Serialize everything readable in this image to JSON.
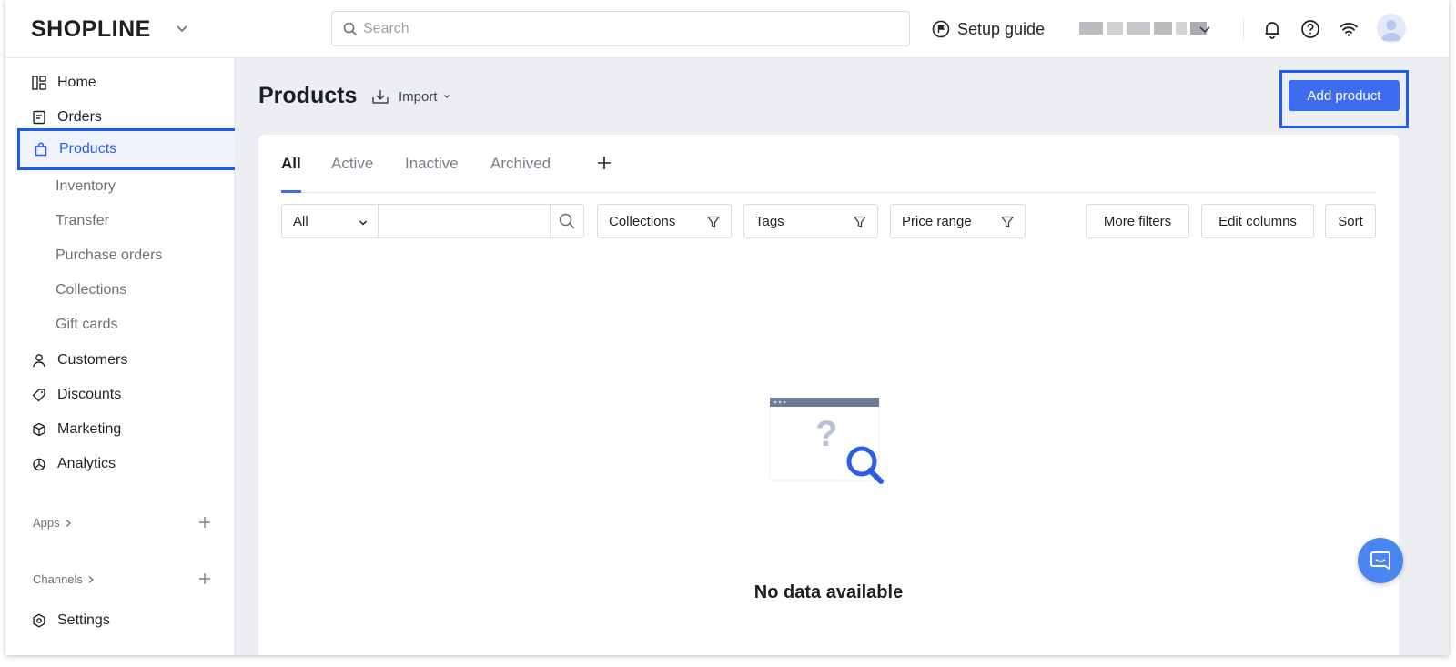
{
  "app": {
    "logo": "SHOPLINE",
    "search_placeholder": "Search",
    "setup_guide": "Setup guide"
  },
  "sidebar": {
    "items": [
      {
        "label": "Home",
        "icon": "home-icon"
      },
      {
        "label": "Orders",
        "icon": "orders-icon"
      },
      {
        "label": "Products",
        "icon": "bag-icon",
        "active": true
      },
      {
        "label": "Inventory",
        "sub": true
      },
      {
        "label": "Transfer",
        "sub": true
      },
      {
        "label": "Purchase orders",
        "sub": true
      },
      {
        "label": "Collections",
        "sub": true
      },
      {
        "label": "Gift cards",
        "sub": true
      },
      {
        "label": "Customers",
        "icon": "user-icon"
      },
      {
        "label": "Discounts",
        "icon": "tag-icon"
      },
      {
        "label": "Marketing",
        "icon": "cube-icon"
      },
      {
        "label": "Analytics",
        "icon": "pie-chart-icon"
      }
    ],
    "apps_label": "Apps",
    "channels_label": "Channels",
    "settings_label": "Settings"
  },
  "page": {
    "title": "Products",
    "import_label": "Import",
    "add_product_label": "Add product"
  },
  "tabs": [
    "All",
    "Active",
    "Inactive",
    "Archived"
  ],
  "filters": {
    "select_value": "All",
    "collections": "Collections",
    "tags": "Tags",
    "price_range": "Price range",
    "more_filters": "More filters",
    "edit_columns": "Edit columns",
    "sort": "Sort"
  },
  "empty_state": {
    "message": "No data available"
  },
  "colors": {
    "accent": "#3d6cf0",
    "highlight": "#1a5cf5",
    "background": "#eceef2"
  }
}
